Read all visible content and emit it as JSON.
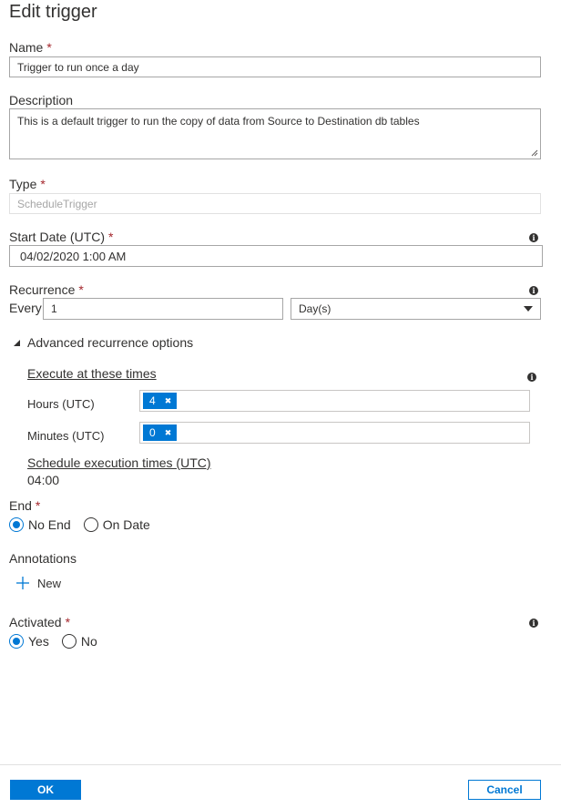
{
  "title": "Edit trigger",
  "required_marker": "*",
  "name": {
    "label": "Name",
    "value": "Trigger to run once a day"
  },
  "description": {
    "label": "Description",
    "value": "This is a default trigger to run the copy of data from Source to Destination db tables"
  },
  "type": {
    "label": "Type",
    "value": "ScheduleTrigger"
  },
  "start_date": {
    "label": "Start Date (UTC)",
    "value": "04/02/2020 1:00 AM"
  },
  "recurrence": {
    "label": "Recurrence",
    "every_label": "Every",
    "interval": "1",
    "unit": "Day(s)"
  },
  "advanced": {
    "label": "Advanced recurrence options",
    "execute_label": "Execute at these times",
    "hours_label": "Hours (UTC)",
    "hours": [
      "4"
    ],
    "minutes_label": "Minutes (UTC)",
    "minutes": [
      "0"
    ],
    "schedule_label": "Schedule execution times (UTC)",
    "schedule_value": "04:00"
  },
  "end": {
    "label": "End",
    "options": [
      "No End",
      "On Date"
    ],
    "selected": "No End"
  },
  "annotations": {
    "label": "Annotations",
    "new_label": "New"
  },
  "activated": {
    "label": "Activated",
    "options": [
      "Yes",
      "No"
    ],
    "selected": "Yes"
  },
  "buttons": {
    "ok": "OK",
    "cancel": "Cancel"
  },
  "icons": {
    "info": "info-icon",
    "chevron": "caret-down-icon",
    "expand": "triangle-expanded-icon",
    "add": "plus-icon",
    "remove": "close-icon"
  },
  "colors": {
    "accent": "#0078d4",
    "required": "#a4262c",
    "text": "#323130"
  }
}
